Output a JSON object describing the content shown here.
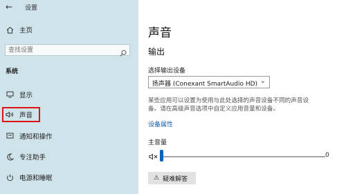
{
  "titlebar": {
    "app_title": "设置"
  },
  "sidebar": {
    "home": "主页",
    "search": {
      "placeholder": "查找设置"
    },
    "section": "系统",
    "items": [
      {
        "label": "显示",
        "icon": "monitor-icon"
      },
      {
        "label": "声音",
        "icon": "speaker-icon",
        "selected": true
      },
      {
        "label": "通知和操作",
        "icon": "notification-icon"
      },
      {
        "label": "专注助手",
        "icon": "moon-icon"
      },
      {
        "label": "电源和睡眠",
        "icon": "power-icon"
      }
    ]
  },
  "main": {
    "title": "声音",
    "output_heading": "输出",
    "choose_output_label": "选择输出设备",
    "output_device": "扬声器 (Conexant SmartAudio HD)",
    "description": "某些应用可以设置为使用与此处选择的声音设备不同的声音设备。请在高级声音选项中自定义应用音量和设备。",
    "device_properties_link": "设备属性",
    "master_volume_label": "主音量",
    "volume_value": "0",
    "troubleshoot_button": "疑难解答"
  },
  "colors": {
    "accent": "#0a64b8",
    "selected_border": "#dd1111",
    "sidebar_bg": "#cfe3ea"
  }
}
